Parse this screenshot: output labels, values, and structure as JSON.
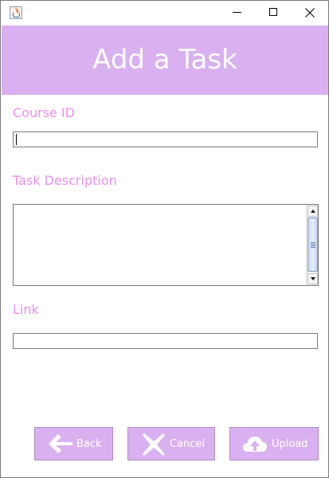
{
  "window": {
    "app_icon": "java-cup-icon",
    "controls": {
      "minimize": "minimize-icon",
      "maximize": "maximize-icon",
      "close": "close-icon"
    }
  },
  "header": {
    "title": "Add a Task"
  },
  "form": {
    "course_id": {
      "label": "Course ID",
      "value": ""
    },
    "task_description": {
      "label": "Task Description",
      "value": ""
    },
    "link": {
      "label": "Link",
      "value": ""
    }
  },
  "buttons": {
    "back": {
      "label": "Back",
      "icon": "arrow-left-icon"
    },
    "cancel": {
      "label": "Cancel",
      "icon": "x-icon"
    },
    "upload": {
      "label": "Upload",
      "icon": "cloud-upload-icon"
    }
  },
  "colors": {
    "accent": "#d9b0f0",
    "label_text": "#ee8ef0",
    "button_text": "#ffffff"
  }
}
